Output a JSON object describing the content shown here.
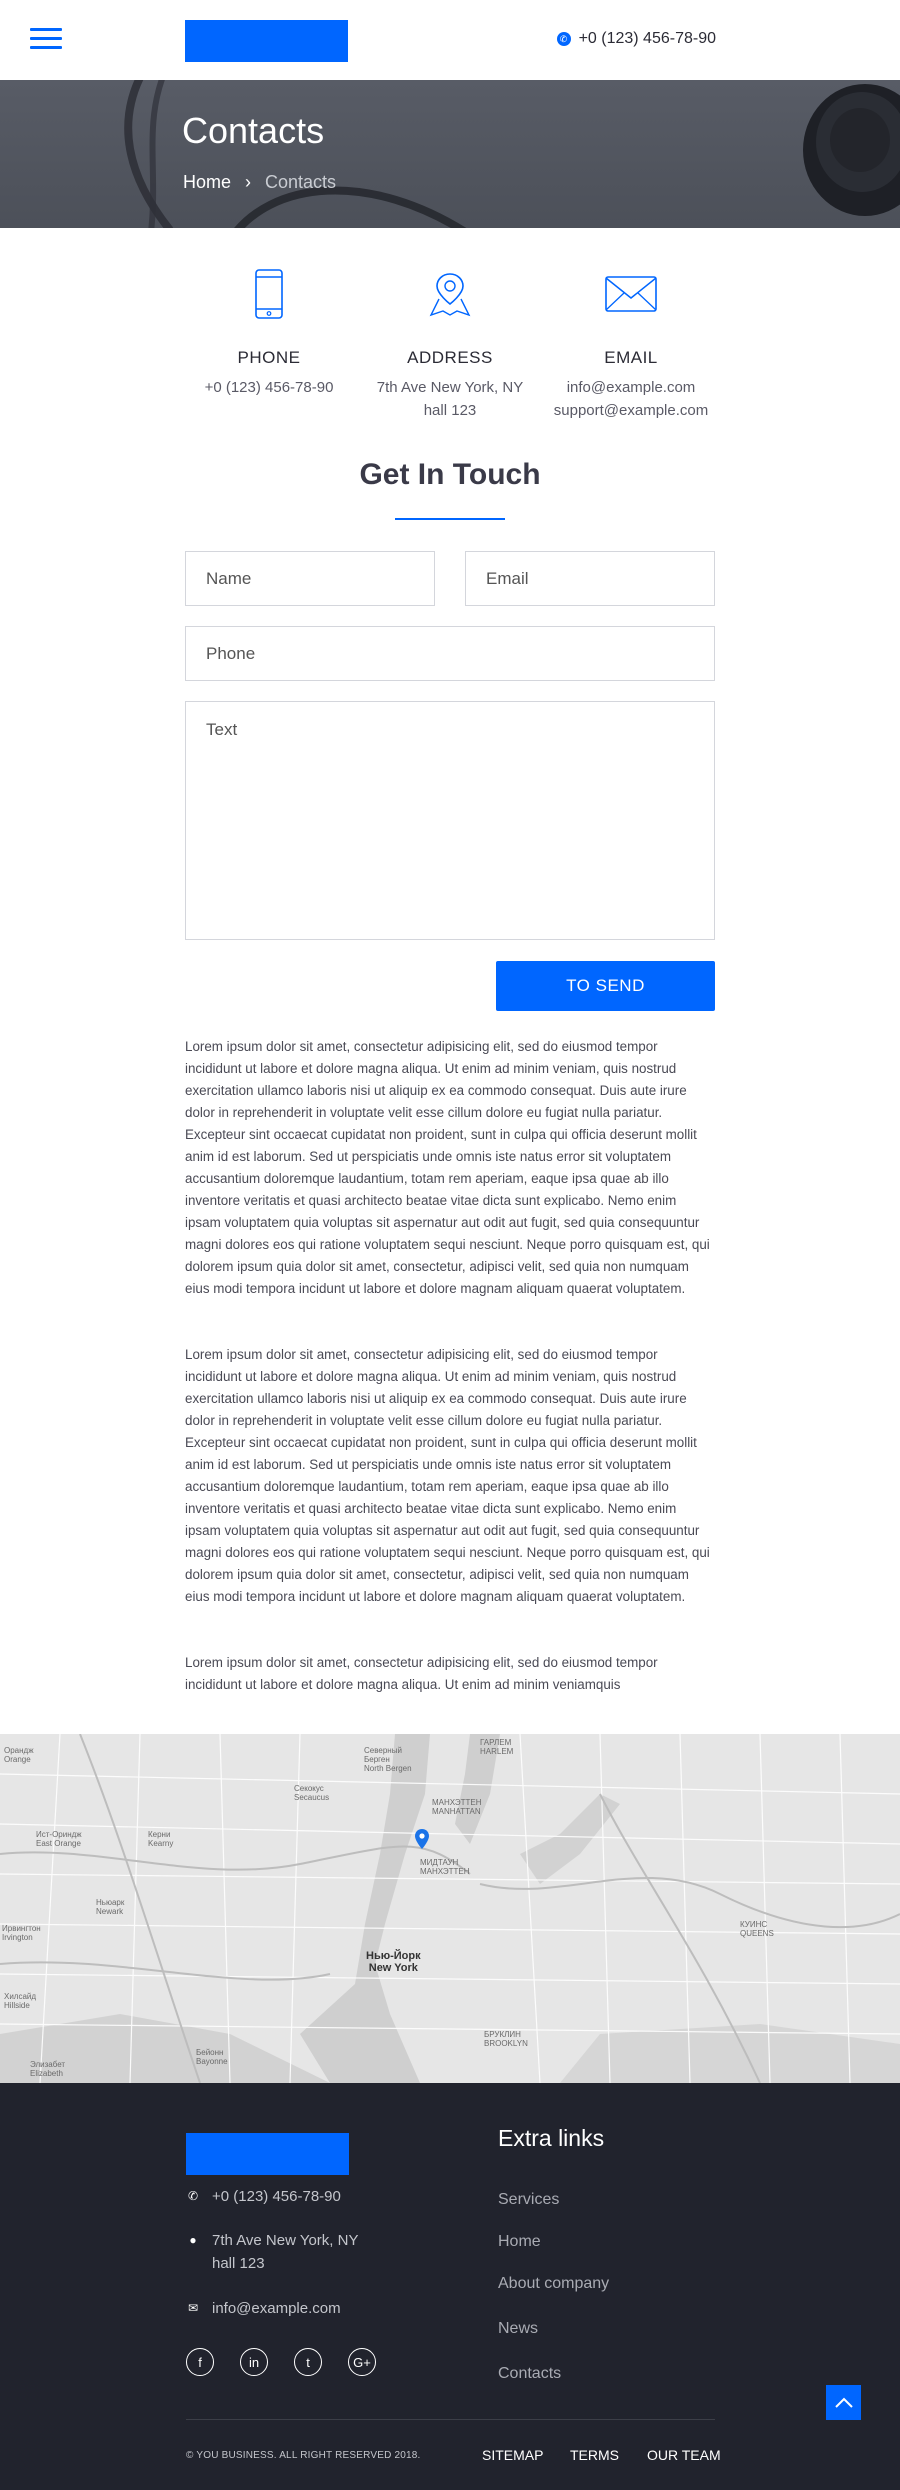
{
  "header": {
    "phone": "+0 (123) 456-78-90"
  },
  "hero": {
    "title": "Contacts",
    "breadcrumb_home": "Home",
    "breadcrumb_separator": "›",
    "breadcrumb_current": "Contacts"
  },
  "contacts": {
    "phone_title": "PHONE",
    "phone_value": "+0 (123) 456-78-90",
    "address_title": "ADDRESS",
    "address_line1": "7th Ave New York, NY",
    "address_line2": "hall 123",
    "email_title": "EMAIL",
    "email_line1": "info@example.com",
    "email_line2": "support@example.com"
  },
  "form": {
    "title": "Get In Touch",
    "name_placeholder": "Name",
    "email_placeholder": "Email",
    "phone_placeholder": "Phone",
    "text_placeholder": "Text",
    "submit_label": "TO SEND"
  },
  "paragraphs": {
    "p1": "Lorem ipsum dolor sit amet, consectetur adipisicing elit, sed do eiusmod tempor incididunt ut labore et dolore magna aliqua. Ut enim ad minim veniam, quis nostrud exercitation ullamco laboris nisi ut aliquip ex ea commodo consequat. Duis aute irure dolor in reprehenderit in voluptate velit esse cillum dolore eu fugiat nulla pariatur. Excepteur sint occaecat cupidatat non proident, sunt in culpa qui officia deserunt mollit anim id est laborum. Sed ut perspiciatis unde omnis iste natus error sit voluptatem accusantium doloremque laudantium, totam rem aperiam, eaque ipsa quae ab illo inventore veritatis et quasi architecto beatae vitae dicta sunt explicabo. Nemo enim ipsam voluptatem quia voluptas sit aspernatur aut odit aut fugit, sed quia consequuntur magni dolores eos qui ratione voluptatem sequi nesciunt. Neque porro quisquam est, qui dolorem ipsum quia dolor sit amet, consectetur, adipisci velit, sed quia non numquam eius modi tempora incidunt ut labore et dolore magnam aliquam quaerat voluptatem.",
    "p2": "Lorem ipsum dolor sit amet, consectetur adipisicing elit, sed do eiusmod tempor incididunt ut labore et dolore magna aliqua. Ut enim ad minim veniam, quis nostrud exercitation ullamco laboris nisi ut aliquip ex ea commodo consequat. Duis aute irure dolor in reprehenderit in voluptate velit esse cillum dolore eu fugiat nulla pariatur. Excepteur sint occaecat cupidatat non proident, sunt in culpa qui officia deserunt mollit anim id est laborum. Sed ut perspiciatis unde omnis iste natus error sit voluptatem accusantium doloremque laudantium, totam rem aperiam, eaque ipsa quae ab illo inventore veritatis et quasi architecto beatae vitae dicta sunt explicabo. Nemo enim ipsam voluptatem quia voluptas sit aspernatur aut odit aut fugit, sed quia consequuntur magni dolores eos qui ratione voluptatem sequi nesciunt. Neque porro quisquam est, qui dolorem ipsum quia dolor sit amet, consectetur, adipisci velit, sed quia non numquam eius modi tempora incidunt ut labore et dolore magnam aliquam quaerat voluptatem.",
    "p3": "Lorem ipsum dolor sit amet, consectetur adipisicing elit, sed do eiusmod tempor incididunt ut labore et dolore magna aliqua. Ut enim ad minim veniamquis"
  },
  "map": {
    "labels": {
      "orange": "Орандж\nOrange",
      "east_orange": "Ист-Ориндж\nEast Orange",
      "kearny": "Керни\nKearny",
      "newark": "Ньюарк\nNewark",
      "irvington": "Ирвингтон\nIrvington",
      "hillside": "Хилсайд\nHillside",
      "elizabeth": "Элизабет\nElizabeth",
      "bayonne": "Бейонн\nBayonne",
      "secaucus": "Секокус\nSecaucus",
      "north_bergen": "Северный\nБерген\nNorth Bergen",
      "manhattan": "МАНХЭТТЕН\nMANHATTAN",
      "midtown": "МИДТАУН\nМАНХЭТТЕН",
      "new_york": "Нью-Йорк\nNew York",
      "brooklyn": "БРУКЛИН\nBROOKLYN",
      "queens": "КУИНС\nQUEENS",
      "harlem": "ГАРЛЕМ\nHARLEM"
    }
  },
  "footer": {
    "phone": "+0 (123) 456-78-90",
    "address_line1": "7th Ave New York, NY",
    "address_line2": "hall 123",
    "email": "info@example.com",
    "extra_title": "Extra links",
    "links": [
      "Services",
      "Home",
      "About company",
      "News",
      "Contacts"
    ],
    "copyright": "© YOU BUSINESS. ALL RIGHT RESERVED 2018.",
    "bottom_links": [
      "SITEMAP",
      "TERMS",
      "OUR TEAM"
    ],
    "socials": [
      "facebook-icon",
      "linkedin-icon",
      "twitter-icon",
      "google-plus-icon"
    ],
    "social_glyphs": [
      "f",
      "in",
      "t",
      "G+"
    ]
  },
  "colors": {
    "accent": "#0066ff",
    "hero_bg": "#52565f",
    "footer_bg": "#21232d"
  }
}
